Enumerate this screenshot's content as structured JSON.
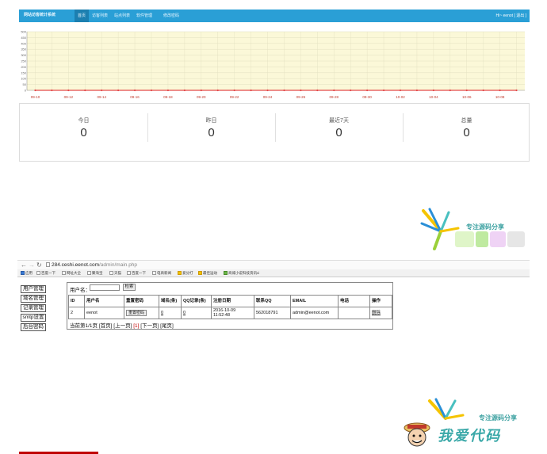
{
  "app": {
    "brand": "网站访客统计系统",
    "nav": [
      "首页",
      "访客列表",
      "站点列表",
      "软件管理",
      "修改密码"
    ],
    "active_nav": 0,
    "user_greeting": "Hi~ eenot",
    "logout_label": "[ 退出 ]"
  },
  "chart_data": {
    "type": "line",
    "title": "",
    "xlabel": "",
    "ylabel": "",
    "categories": [
      "09-10",
      "09-11",
      "09-12",
      "09-13",
      "09-14",
      "09-15",
      "09-16",
      "09-17",
      "09-18",
      "09-19",
      "09-20",
      "09-21",
      "09-22",
      "09-23",
      "09-24",
      "09-25",
      "09-26",
      "09-27",
      "09-28",
      "09-29",
      "09-30",
      "10-01",
      "10-02",
      "10-03",
      "10-04",
      "10-05",
      "10-06",
      "10-07",
      "10-08",
      "10-09"
    ],
    "tick_labels": [
      "09-10",
      "09-12",
      "09-14",
      "09-16",
      "09-18",
      "09-20",
      "09-22",
      "09-24",
      "09-26",
      "09-28",
      "09-30",
      "10-02",
      "10-04",
      "10-06",
      "10-08"
    ],
    "y_ticks": [
      0,
      50,
      100,
      150,
      200,
      250,
      300,
      350,
      400,
      450,
      500
    ],
    "ylim": [
      0,
      500
    ],
    "series": [
      {
        "values": [
          0,
          0,
          0,
          0,
          0,
          0,
          0,
          0,
          0,
          0,
          0,
          0,
          0,
          0,
          0,
          0,
          0,
          0,
          0,
          0,
          0,
          0,
          0,
          0,
          0,
          0,
          0,
          0,
          0,
          0
        ]
      }
    ],
    "grid": true,
    "colors": {
      "background": "#fbf8d8",
      "line": "#e34a4a",
      "grid": "#e2dfc0"
    }
  },
  "stats": [
    {
      "label": "今日",
      "value": "0"
    },
    {
      "label": "昨日",
      "value": "0"
    },
    {
      "label": "最近7天",
      "value": "0"
    },
    {
      "label": "总量",
      "value": "0"
    }
  ],
  "watermark": {
    "text": "专注源码分享",
    "cn_logo": "我爱代码"
  },
  "browser": {
    "url_host": "284.ceshi.eenot.com",
    "url_path": "/admin/main.php",
    "bookmarks": [
      "应用",
      "百度一下",
      "网址大全",
      "聚淘宝",
      "天猫",
      "百度一下",
      "电商新闻",
      "爱分打",
      "最佳运动",
      "商城小说科技资讯ci"
    ]
  },
  "admin": {
    "side_menu": [
      "用户管理",
      "域名管理",
      "记录管理",
      "smtp设置",
      "后台密码"
    ],
    "search_label": "用户名：",
    "search_value": "",
    "search_button": "检索",
    "table": {
      "headers": [
        "ID",
        "用户名",
        "重置密码",
        "域名(条)",
        "QQ记录(条)",
        "注册日期",
        "联系QQ",
        "EMAIL",
        "电话",
        "操作"
      ],
      "rows": [
        {
          "id": "2",
          "username": "eenot",
          "reset_label": "重置密码",
          "domains": "0",
          "qq_records": "0",
          "reg_date": "2016-10-09 11:52:48",
          "contact_qq": "562018791",
          "email": "admin@eenot.com",
          "phone": "",
          "action": "删除"
        }
      ]
    },
    "pager": {
      "prefix": "当前第1/1页 [首页] [上一页] ",
      "current": "[1]",
      "suffix": " [下一页] [尾页]"
    }
  },
  "colors": {
    "topbar": "#2a9fd6",
    "topbar_active": "#1c7fb0",
    "pager_current": "#c00000"
  }
}
